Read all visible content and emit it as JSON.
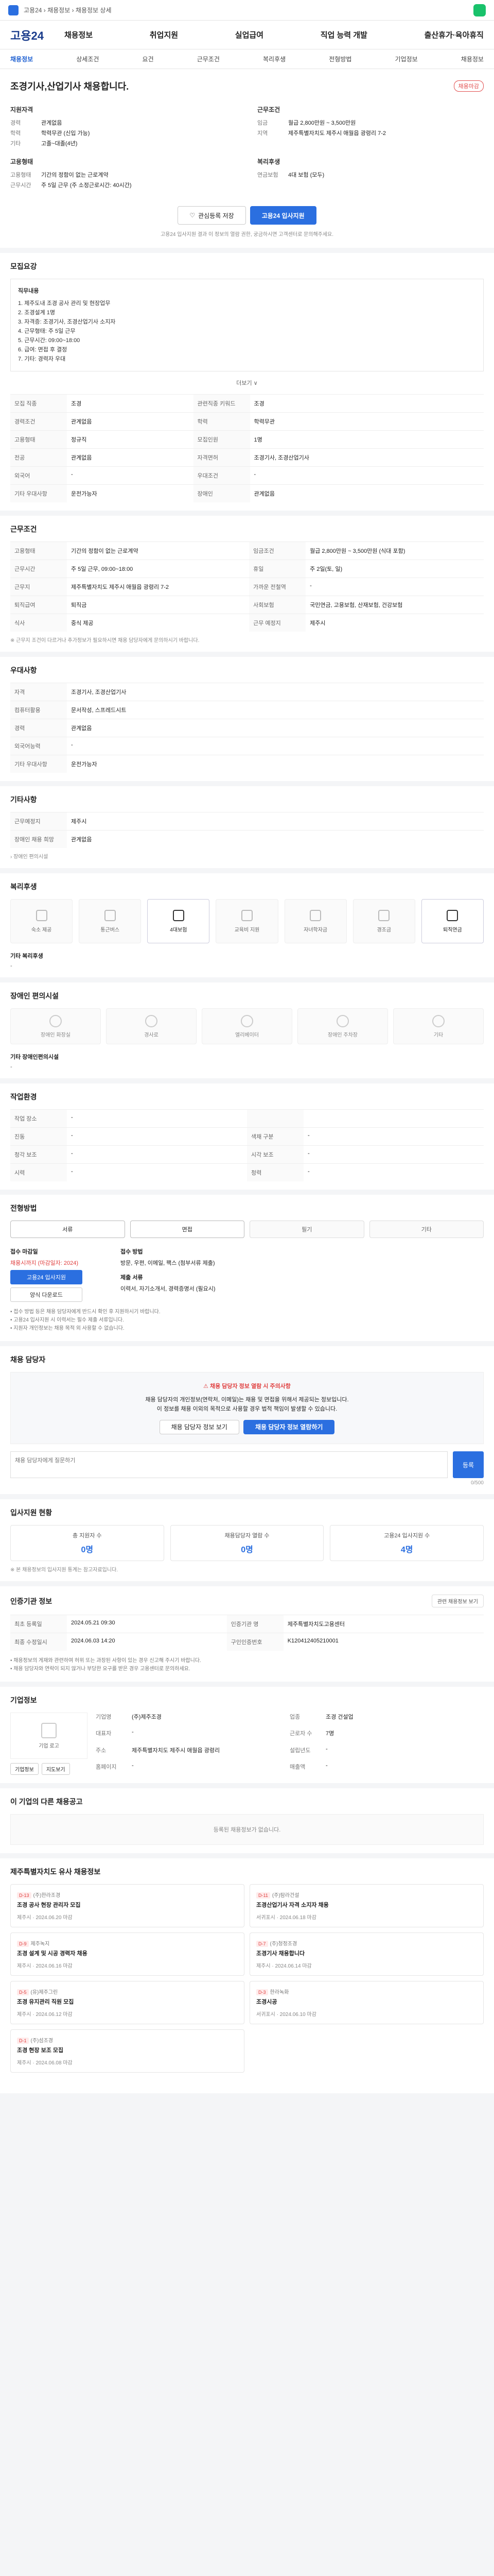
{
  "topbar": {
    "breadcrumb": "고용24 › 채용정보 › 채용정보 상세"
  },
  "header": {
    "brand": "고용24",
    "gnb": [
      "채용정보",
      "취업지원",
      "실업급여",
      "직업 능력 개발",
      "출산휴가·육아휴직"
    ]
  },
  "subnav": [
    "채용정보",
    "상세조건",
    "요건",
    "근무조건",
    "복리후생",
    "전형방법",
    "기업정보",
    "채용정보"
  ],
  "job": {
    "title": "조경기사,산업기사 채용합니다.",
    "badge": "채용마감",
    "applicant_group_title": "지원자격",
    "applicant_rows": [
      {
        "k": "경력",
        "v": "관계없음"
      },
      {
        "k": "학력",
        "v": "학력무관 (신입 가능)"
      },
      {
        "k": "기타",
        "v": "고졸~대졸(4년)"
      }
    ],
    "work_group_title": "근무조건",
    "work_rows": [
      {
        "k": "임금",
        "v": "월급 2,800만원 ~ 3,500만원"
      },
      {
        "k": "지역",
        "v": "제주특별자치도 제주시 애월읍 광령리 7-2"
      }
    ],
    "contract_group_title": "고용형태",
    "contract_rows": [
      {
        "k": "고용형태",
        "v": "기간의 정함이 없는 근로계약"
      },
      {
        "k": "근무시간",
        "v": "주 5일 근무 (주 소정근로시간: 40시간)"
      }
    ],
    "welfare_group_title": "복리후생",
    "welfare_rows": [
      {
        "k": "연금보험",
        "v": "4대 보험 (모두)"
      }
    ],
    "btn_save": "관심등록 저장",
    "btn_apply": "고용24 입사지원",
    "notice": "고용24 입사지원 결과 이 정보의 열람 권한, 궁금하시면 고객센터로 문의해주세요."
  },
  "detail": {
    "title": "모집요강",
    "job_title_label": "직무내용",
    "job_lines": [
      "1. 제주도내 조경 공사 관리 및 현장업무",
      "2. 조경설계 1명",
      "3. 자격증: 조경기사, 조경산업기사 소지자",
      "4. 근무형태: 주 5일 근무",
      "5. 근무시간: 09:00~18:00",
      "6. 급여: 면접 후 결정",
      "7. 기타: 경력자 우대"
    ],
    "more": "더보기 ∨",
    "rows": [
      [
        "모집 직종",
        "조경",
        "관련직종 키워드",
        "조경"
      ],
      [
        "경력조건",
        "관계없음",
        "학력",
        "학력무관"
      ],
      [
        "고용형태",
        "정규직",
        "모집인원",
        "1명"
      ],
      [
        "전공",
        "관계없음",
        "자격면허",
        "조경기사, 조경산업기사"
      ],
      [
        "외국어",
        "-",
        "우대조건",
        "-"
      ],
      [
        "기타 우대사항",
        "운전가능자",
        "장애인",
        "관계없음"
      ]
    ]
  },
  "conditions": {
    "title": "근무조건",
    "rows": [
      [
        "고용형태",
        "기간의 정함이 없는 근로계약",
        "임금조건",
        "월급 2,800만원 ~ 3,500만원 (식대 포함)"
      ],
      [
        "근무시간",
        "주 5일 근무, 09:00~18:00",
        "휴일",
        "주 2일(토, 일)"
      ],
      [
        "근무지",
        "제주특별자치도 제주시 애월읍 광령리 7-2",
        "가까운 전철역",
        "-"
      ],
      [
        "퇴직급여",
        "퇴직금",
        "사회보험",
        "국민연금, 고용보험, 산재보험, 건강보험"
      ],
      [
        "식사",
        "중식 제공",
        "근무 예정지",
        "제주시"
      ]
    ],
    "footnote": "※ 근무지 조건이 다르거나 추가정보가 필요하시면 채용 담당자에게 문의하시기 바랍니다."
  },
  "welfare": {
    "title": "우대사항",
    "rows": [
      [
        "자격",
        "조경기사, 조경산업기사"
      ],
      [
        "컴퓨터활용",
        "문서작성, 스프레드시트"
      ],
      [
        "경력",
        "관계없음"
      ],
      [
        "외국어능력",
        "-"
      ],
      [
        "기타 우대사항",
        "운전가능자"
      ]
    ]
  },
  "other": {
    "title": "기타사항",
    "rows": [
      [
        "근무예정지",
        "제주시"
      ],
      [
        "장애인 채용 희망",
        "관계없음"
      ]
    ],
    "link": "› 장애인 편의시설"
  },
  "benefits": {
    "title": "복리후생",
    "items": [
      {
        "label": "숙소 제공",
        "on": false
      },
      {
        "label": "통근버스",
        "on": false
      },
      {
        "label": "4대보험",
        "on": true
      },
      {
        "label": "교육비 지원",
        "on": false
      },
      {
        "label": "자녀학자금",
        "on": false
      },
      {
        "label": "경조금",
        "on": false
      },
      {
        "label": "퇴직연금",
        "on": true
      }
    ],
    "extra_title": "기타 복리후생",
    "extra_value": "-"
  },
  "disability": {
    "title": "장애인 편의시설",
    "items": [
      "장애인 화장실",
      "경사로",
      "엘리베이터",
      "장애인 주차장",
      "기타"
    ],
    "extra_title": "기타 장애인편의시설",
    "extra_value": "-"
  },
  "work_env": {
    "title": "작업환경",
    "rows": [
      [
        "작업 장소",
        "-",
        "",
        ""
      ],
      [
        "진동",
        "-",
        "색채 구분",
        "-"
      ],
      [
        "청각 보조",
        "-",
        "시각 보조",
        "-"
      ],
      [
        "시력",
        "-",
        "청력",
        "-"
      ]
    ]
  },
  "selection": {
    "title": "전형방법",
    "steps": [
      "서류",
      "면접",
      "필기",
      "기타"
    ],
    "apply_title": "접수 마감일",
    "apply_date": "채용시까지 (마감일자: 2024)",
    "method_title": "접수 방법",
    "method_value": "방문, 우편, 이메일, 팩스 (첨부서류 제출)",
    "docs_title": "제출 서류",
    "docs_value": "이력서, 자기소개서, 경력증명서 (필요시)",
    "btn_apply": "고용24 입사지원",
    "btn_sample": "양식 다운로드",
    "notes": [
      "• 접수 방법 등은 채용 담당자에게 반드시 확인 후 지원하시기 바랍니다.",
      "• 고용24 입사지원 시 이력서는 필수 제출 서류입니다.",
      "• 지원자 개인정보는 채용 목적 외 사용할 수 없습니다."
    ]
  },
  "contact": {
    "title": "채용 담당자",
    "warning": "⚠ 채용 담당자 정보 열람 시 주의사항",
    "lines": [
      "채용 담당자의 개인정보(연락처, 이메일)는 채용 및 면접을 위해서 제공되는 정보입니다.",
      "이 정보를 채용 이외의 목적으로 사용할 경우 법적 책임이 발생할 수 있습니다."
    ],
    "btn_phone": "채용 담당자 정보 보기",
    "btn_inquiry": "채용 담당자 정보 열람하기"
  },
  "qna": {
    "placeholder": "채용 담당자에게 질문하기",
    "send": "등록",
    "count": "0/500"
  },
  "counts": {
    "title": "입사지원 현황",
    "items": [
      {
        "label": "총 지원자 수",
        "value": "0명"
      },
      {
        "label": "채용담당자 열람 수",
        "value": "0명"
      },
      {
        "label": "고용24 입사지원 수",
        "value": "4명"
      }
    ],
    "note": "※ 본 채용정보의 입사지원 통계는 참고자료입니다."
  },
  "manage": {
    "title": "인증기관 정보",
    "button": "관련 채용정보 보기",
    "rows": [
      [
        "최초 등록일",
        "2024.05.21 09:30",
        "인증기관 명",
        "제주특별자치도고용센터"
      ],
      [
        "최종 수정일시",
        "2024.06.03 14:20",
        "구인인증번호",
        "K120412405210001"
      ]
    ],
    "notes": [
      "• 채용정보의 게재와 관련하여 허위 또는 과장된 사항이 있는 경우 신고해 주시기 바랍니다.",
      "• 채용 담당자와 연락이 되지 않거나 부당한 요구를 받은 경우 고용센터로 문의하세요."
    ]
  },
  "company": {
    "title": "기업정보",
    "logo_label": "기업 로고",
    "btn_info": "기업정보",
    "btn_map": "지도보기",
    "rows": [
      [
        "기업명",
        "(주)제주조경",
        "업종",
        "조경 건설업"
      ],
      [
        "대표자",
        "-",
        "근로자 수",
        "7명"
      ],
      [
        "주소",
        "제주특별자치도 제주시 애월읍 광령리",
        "설립년도",
        "-"
      ],
      [
        "홈페이지",
        "-",
        "매출액",
        "-"
      ]
    ]
  },
  "related": {
    "title": "이 기업의 다른 채용공고",
    "empty": "등록된 채용정보가 없습니다."
  },
  "similar": {
    "title": "제주특별자치도 유사 채용정보",
    "cards": [
      {
        "d": "D-13",
        "company": "(주)한라조경",
        "title": "조경 공사 현장 관리자 모집",
        "meta": "제주시 · 2024.06.20 마감"
      },
      {
        "d": "D-11",
        "company": "(주)탐라건설",
        "title": "조경산업기사 자격 소지자 채용",
        "meta": "서귀포시 · 2024.06.18 마감"
      },
      {
        "d": "D-9",
        "company": "제주녹지",
        "title": "조경 설계 및 시공 경력자 채용",
        "meta": "제주시 · 2024.06.16 마감"
      },
      {
        "d": "D-7",
        "company": "(주)청정조경",
        "title": "조경기사 채용합니다",
        "meta": "제주시 · 2024.06.14 마감"
      },
      {
        "d": "D-5",
        "company": "(유)제주그린",
        "title": "조경 유지관리 직원 모집",
        "meta": "제주시 · 2024.06.12 마감"
      },
      {
        "d": "D-3",
        "company": "한라녹화",
        "title": "조경시공",
        "meta": "서귀포시 · 2024.06.10 마감"
      },
      {
        "d": "D-1",
        "company": "(주)섬조경",
        "title": "조경 현장 보조 모집",
        "meta": "제주시 · 2024.06.08 마감"
      }
    ]
  },
  "colors": {
    "accent": "#2b6fe0",
    "brand": "#1a3c8c",
    "danger": "#e04040"
  }
}
